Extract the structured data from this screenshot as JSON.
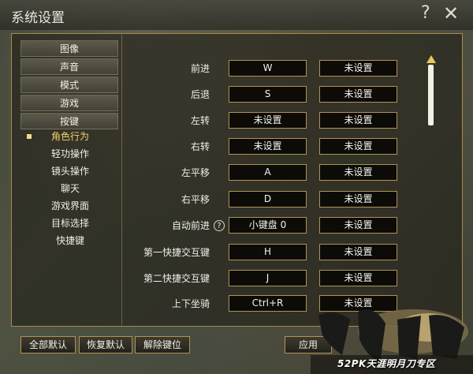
{
  "window": {
    "title": "系统设置",
    "help_glyph": "?",
    "close_glyph": "✕"
  },
  "sidebar": {
    "tabs": [
      {
        "label": "图像"
      },
      {
        "label": "声音"
      },
      {
        "label": "模式"
      },
      {
        "label": "游戏"
      },
      {
        "label": "按键"
      }
    ],
    "sub_items": [
      {
        "label": "角色行为",
        "active": true
      },
      {
        "label": "轻功操作"
      },
      {
        "label": "镜头操作"
      },
      {
        "label": "聊天"
      },
      {
        "label": "游戏界面"
      },
      {
        "label": "目标选择"
      },
      {
        "label": "快捷键"
      }
    ]
  },
  "bindings": [
    {
      "action": "前进",
      "primary": "W",
      "secondary": "未设置"
    },
    {
      "action": "后退",
      "primary": "S",
      "secondary": "未设置"
    },
    {
      "action": "左转",
      "primary": "未设置",
      "secondary": "未设置"
    },
    {
      "action": "右转",
      "primary": "未设置",
      "secondary": "未设置"
    },
    {
      "action": "左平移",
      "primary": "A",
      "secondary": "未设置"
    },
    {
      "action": "右平移",
      "primary": "D",
      "secondary": "未设置"
    },
    {
      "action": "自动前进",
      "primary": "小键盘 0",
      "secondary": "未设置",
      "help": "?"
    },
    {
      "action": "第一快捷交互键",
      "primary": "H",
      "secondary": "未设置"
    },
    {
      "action": "第二快捷交互键",
      "primary": "J",
      "secondary": "未设置"
    },
    {
      "action": "上下坐骑",
      "primary": "Ctrl+R",
      "secondary": "未设置"
    }
  ],
  "footer": {
    "reset_all": "全部默认",
    "restore_default": "恢复默认",
    "unbind": "解除键位",
    "apply": "应用"
  },
  "watermark": {
    "text": "52PK天涯明月刀专区"
  },
  "colors": {
    "accent_border": "#b09352",
    "active_text": "#f4d36b",
    "scroll_arrow": "#e7c95a"
  }
}
